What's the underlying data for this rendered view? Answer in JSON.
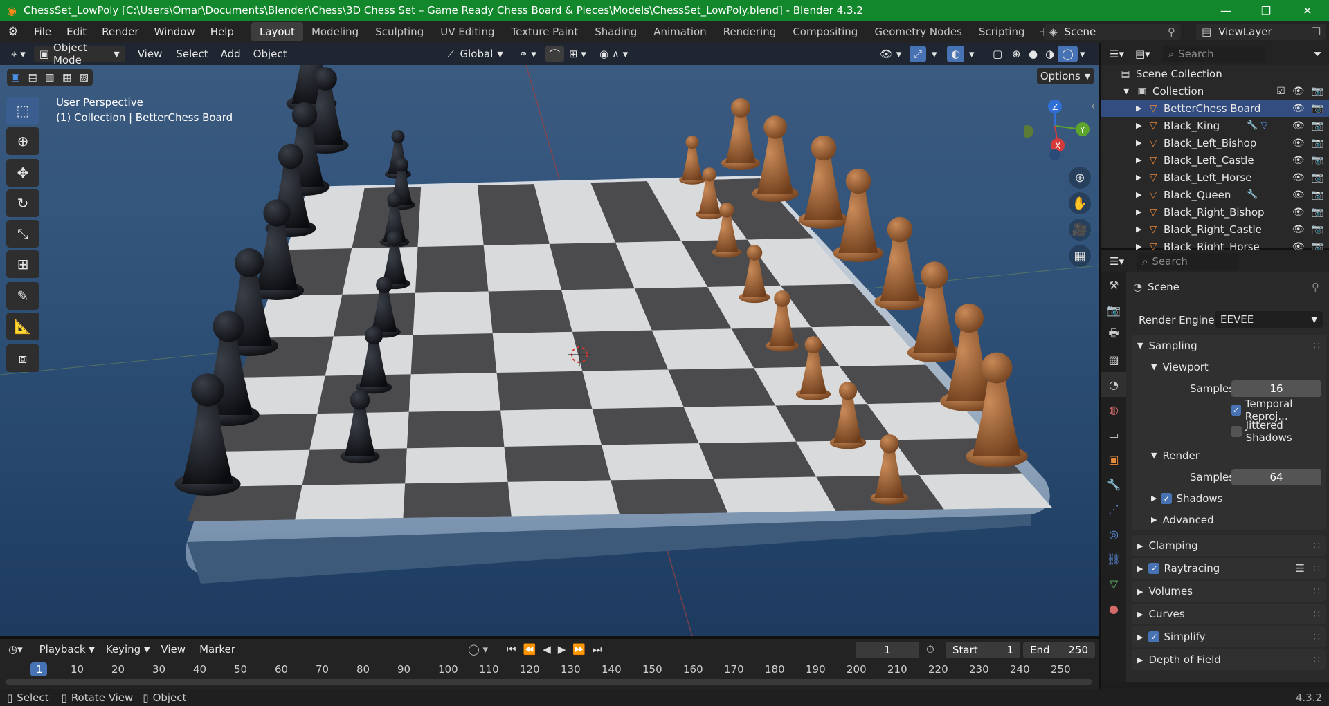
{
  "window": {
    "title": "ChessSet_LowPoly [C:\\Users\\Omar\\Documents\\Blender\\Chess\\3D Chess Set – Game Ready Chess Board & Pieces\\Models\\ChessSet_LowPoly.blend] - Blender 4.3.2"
  },
  "menu": [
    "File",
    "Edit",
    "Render",
    "Window",
    "Help"
  ],
  "workspaces": [
    "Layout",
    "Modeling",
    "Sculpting",
    "UV Editing",
    "Texture Paint",
    "Shading",
    "Animation",
    "Rendering",
    "Compositing",
    "Geometry Nodes",
    "Scripting"
  ],
  "active_workspace": "Layout",
  "scene_field": "Scene",
  "viewlayer_field": "ViewLayer",
  "viewport_header": {
    "mode": "Object Mode",
    "items": [
      "View",
      "Select",
      "Add",
      "Object"
    ],
    "transform": "Global"
  },
  "viewport": {
    "line1": "User Perspective",
    "line2": "(1) Collection | BetterChess Board",
    "options": "Options",
    "gizmo": {
      "z": "Z",
      "y": "Y",
      "x": "X"
    }
  },
  "outliner": {
    "search_placeholder": "Search",
    "scene_collection": "Scene Collection",
    "collection": "Collection",
    "items": [
      "BetterChess Board",
      "Black_King",
      "Black_Left_Bishop",
      "Black_Left_Castle",
      "Black_Left_Horse",
      "Black_Queen",
      "Black_Right_Bishop",
      "Black_Right_Castle",
      "Black_Right_Horse"
    ]
  },
  "properties": {
    "search_placeholder": "Search",
    "context": "Scene",
    "render_engine_label": "Render Engine",
    "render_engine": "EEVEE",
    "sampling": "Sampling",
    "viewport": "Viewport",
    "samples_label": "Samples",
    "viewport_samples": "16",
    "temporal": "Temporal Reproj...",
    "jittered": "Jittered Shadows",
    "render": "Render",
    "render_samples": "64",
    "shadows": "Shadows",
    "advanced": "Advanced",
    "sections": [
      "Clamping",
      "Raytracing",
      "Volumes",
      "Curves",
      "Simplify",
      "Depth of Field"
    ]
  },
  "timeline": {
    "items": [
      "Playback",
      "Keying",
      "View",
      "Marker"
    ],
    "current_frame": "1",
    "start_label": "Start",
    "start": "1",
    "end_label": "End",
    "end": "250",
    "ruler": [
      "1",
      "10",
      "20",
      "30",
      "40",
      "50",
      "60",
      "70",
      "80",
      "90",
      "100",
      "110",
      "120",
      "130",
      "140",
      "150",
      "160",
      "170",
      "180",
      "190",
      "200",
      "210",
      "220",
      "230",
      "240",
      "250"
    ]
  },
  "status": {
    "select": "Select",
    "rotate": "Rotate View",
    "object": "Object",
    "version": "4.3.2"
  },
  "colors": {
    "title_green": "#13872c",
    "accent_blue": "#4772b3",
    "active_workspace": "#3d3d3d"
  }
}
